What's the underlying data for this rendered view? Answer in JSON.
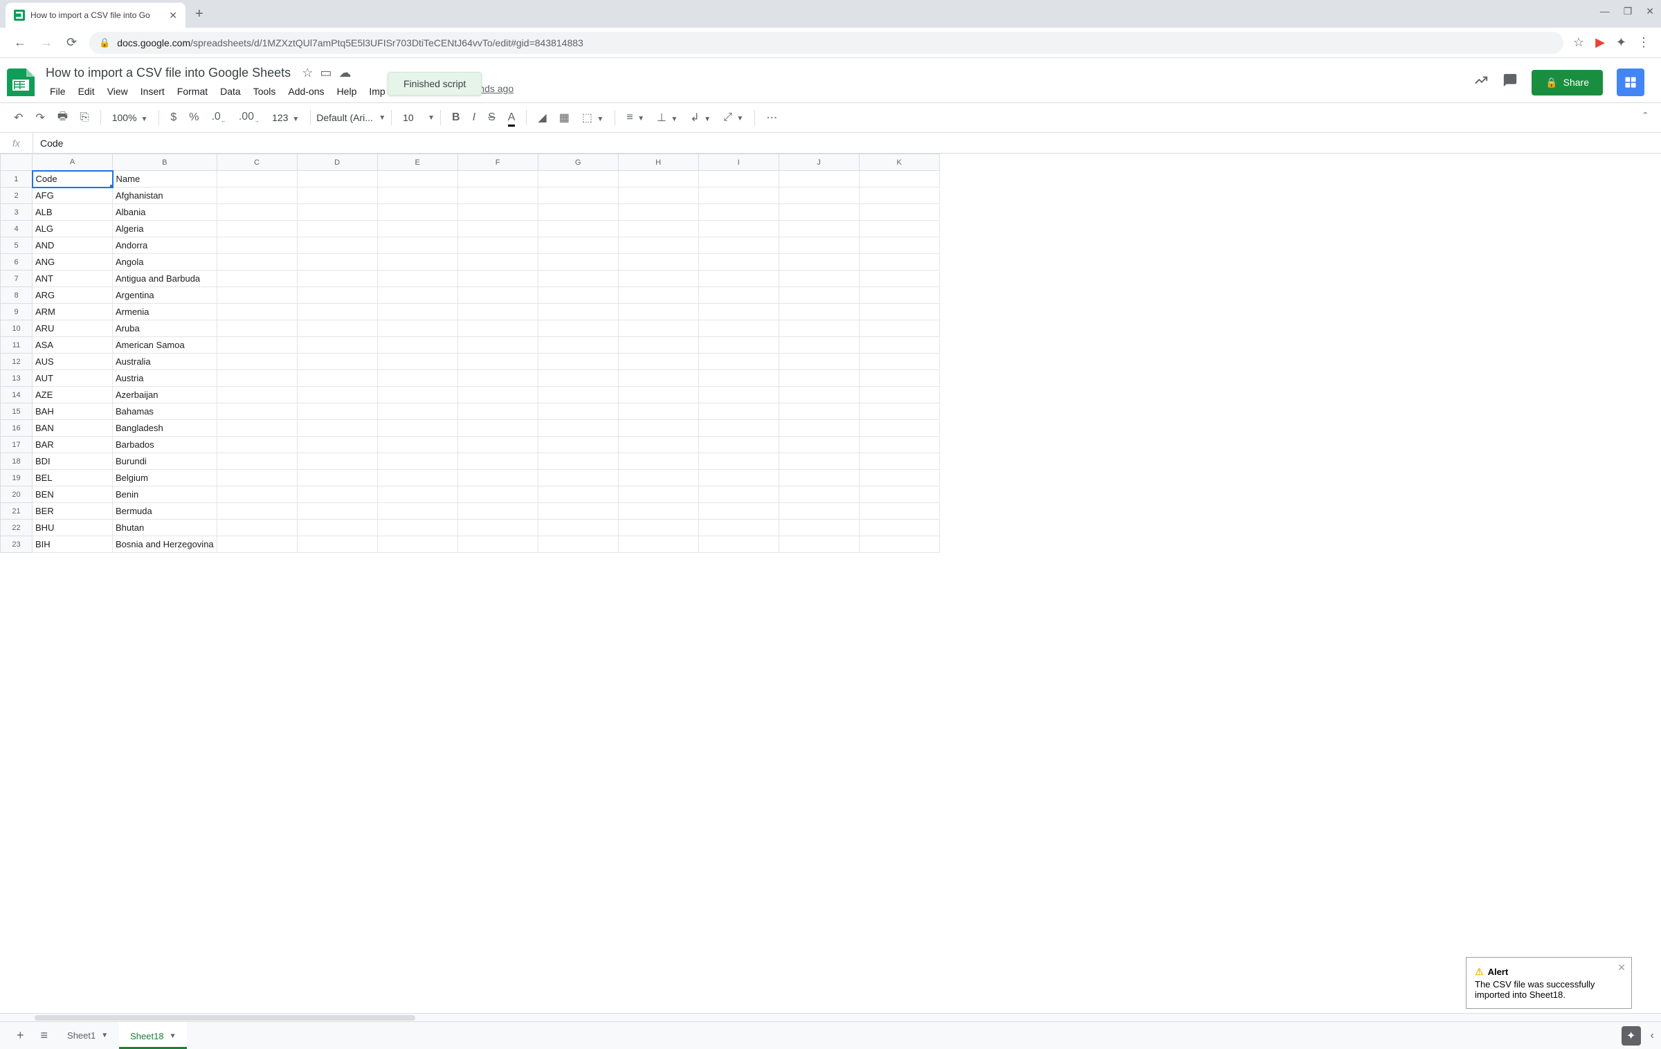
{
  "browser": {
    "tab_title": "How to import a CSV file into Go",
    "url_host": "docs.google.com",
    "url_path": "/spreadsheets/d/1MZXztQUl7amPtq5E5l3UFISr703DtiTeCENtJ64vvTo/edit#gid=843814883"
  },
  "doc": {
    "title": "How to import a CSV file into Google Sheets",
    "edit_status": "st edit was seconds ago",
    "toast": "Finished script",
    "share_label": "Share"
  },
  "menu": [
    "File",
    "Edit",
    "View",
    "Insert",
    "Format",
    "Data",
    "Tools",
    "Add-ons",
    "Help",
    "Imp"
  ],
  "toolbar": {
    "zoom": "100%",
    "font": "Default (Ari...",
    "font_size": "10"
  },
  "formula": {
    "value": "Code"
  },
  "columns": [
    "A",
    "B",
    "C",
    "D",
    "E",
    "F",
    "G",
    "H",
    "I",
    "J",
    "K"
  ],
  "rows": [
    {
      "n": 1,
      "A": "Code",
      "B": "Name"
    },
    {
      "n": 2,
      "A": "AFG",
      "B": "Afghanistan"
    },
    {
      "n": 3,
      "A": "ALB",
      "B": "Albania"
    },
    {
      "n": 4,
      "A": "ALG",
      "B": "Algeria"
    },
    {
      "n": 5,
      "A": "AND",
      "B": "Andorra"
    },
    {
      "n": 6,
      "A": "ANG",
      "B": "Angola"
    },
    {
      "n": 7,
      "A": "ANT",
      "B": "Antigua and Barbuda"
    },
    {
      "n": 8,
      "A": "ARG",
      "B": "Argentina"
    },
    {
      "n": 9,
      "A": "ARM",
      "B": "Armenia"
    },
    {
      "n": 10,
      "A": "ARU",
      "B": "Aruba"
    },
    {
      "n": 11,
      "A": "ASA",
      "B": "American Samoa"
    },
    {
      "n": 12,
      "A": "AUS",
      "B": "Australia"
    },
    {
      "n": 13,
      "A": "AUT",
      "B": "Austria"
    },
    {
      "n": 14,
      "A": "AZE",
      "B": "Azerbaijan"
    },
    {
      "n": 15,
      "A": "BAH",
      "B": "Bahamas"
    },
    {
      "n": 16,
      "A": "BAN",
      "B": "Bangladesh"
    },
    {
      "n": 17,
      "A": "BAR",
      "B": "Barbados"
    },
    {
      "n": 18,
      "A": "BDI",
      "B": "Burundi"
    },
    {
      "n": 19,
      "A": "BEL",
      "B": "Belgium"
    },
    {
      "n": 20,
      "A": "BEN",
      "B": "Benin"
    },
    {
      "n": 21,
      "A": "BER",
      "B": "Bermuda"
    },
    {
      "n": 22,
      "A": "BHU",
      "B": "Bhutan"
    },
    {
      "n": 23,
      "A": "BIH",
      "B": "Bosnia and Herzegovina"
    }
  ],
  "alert": {
    "title": "Alert",
    "body": "The CSV file was successfully imported into Sheet18."
  },
  "tabs": [
    {
      "name": "Sheet1",
      "active": false
    },
    {
      "name": "Sheet18",
      "active": true
    }
  ]
}
